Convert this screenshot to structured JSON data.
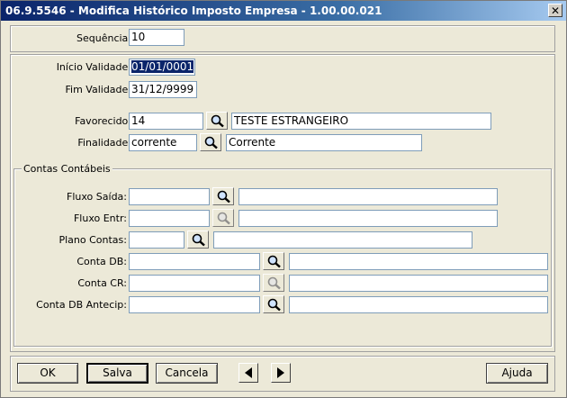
{
  "window": {
    "title": "06.9.5546 - Modifica Histórico Imposto Empresa - 1.00.00.021",
    "close_glyph": "✕"
  },
  "sequencia": {
    "label": "Sequência:",
    "value": "10"
  },
  "validade": {
    "inicio_label": "Início Validade:",
    "inicio_value": "01/01/0001",
    "fim_label": "Fim Validade:",
    "fim_value": "31/12/9999"
  },
  "favorecido": {
    "label": "Favorecido:",
    "code": "14",
    "description": "TESTE ESTRANGEIRO",
    "icon": "magnifier-icon"
  },
  "finalidade": {
    "label": "Finalidade:",
    "code": "corrente",
    "description": "Corrente",
    "icon": "magnifier-icon"
  },
  "contas": {
    "legend": "Contas Contábeis",
    "fluxo_saida": {
      "label": "Fluxo Saída:",
      "code": "",
      "description": ""
    },
    "fluxo_entr": {
      "label": "Fluxo Entr:",
      "code": "",
      "description": ""
    },
    "plano_contas": {
      "label": "Plano Contas:",
      "code": "",
      "description": ""
    },
    "conta_db": {
      "label": "Conta DB:",
      "code": "",
      "description": ""
    },
    "conta_cr": {
      "label": "Conta CR:",
      "code": "",
      "description": ""
    },
    "conta_db_antecip": {
      "label": "Conta DB Antecip:",
      "code": "",
      "description": ""
    }
  },
  "footer": {
    "ok_label": "OK",
    "salva_label": "Salva",
    "cancela_label": "Cancela",
    "ajuda_label": "Ajuda"
  },
  "colors": {
    "title_start": "#0a246a",
    "title_end": "#a6caf0",
    "selection": "#0a246a"
  }
}
